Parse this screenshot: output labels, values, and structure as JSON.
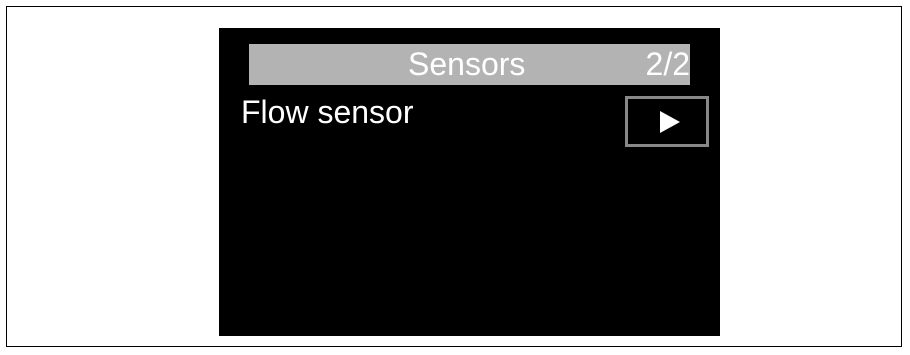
{
  "screen": {
    "header": {
      "title": "Sensors",
      "page_indicator": "2/2"
    },
    "menu": {
      "items": [
        {
          "label": "Flow sensor"
        }
      ]
    },
    "enter_button": {
      "icon": "play-arrow-icon"
    }
  },
  "colors": {
    "screen_background": "#000000",
    "header_background": "#b3b3b3",
    "text": "#ffffff",
    "button_border": "#888888"
  }
}
